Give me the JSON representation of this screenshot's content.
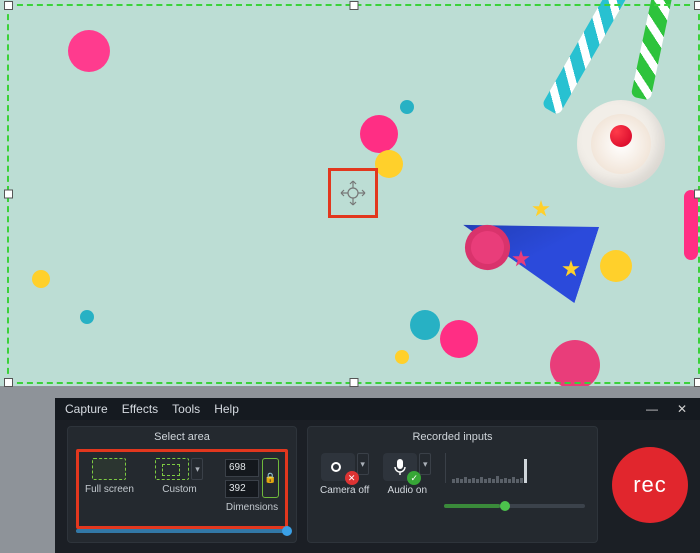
{
  "menu": {
    "capture": "Capture",
    "effects": "Effects",
    "tools": "Tools",
    "help": "Help"
  },
  "sections": {
    "select_area": "Select area",
    "recorded_inputs": "Recorded inputs"
  },
  "select_area": {
    "full_screen": "Full screen",
    "custom": "Custom",
    "dimensions": "Dimensions",
    "width": "698",
    "height": "392"
  },
  "inputs": {
    "camera_label": "Camera off",
    "audio_label": "Audio on"
  },
  "record": {
    "label": "rec"
  },
  "colors": {
    "highlight": "#e2371e",
    "record": "#e1262d"
  }
}
